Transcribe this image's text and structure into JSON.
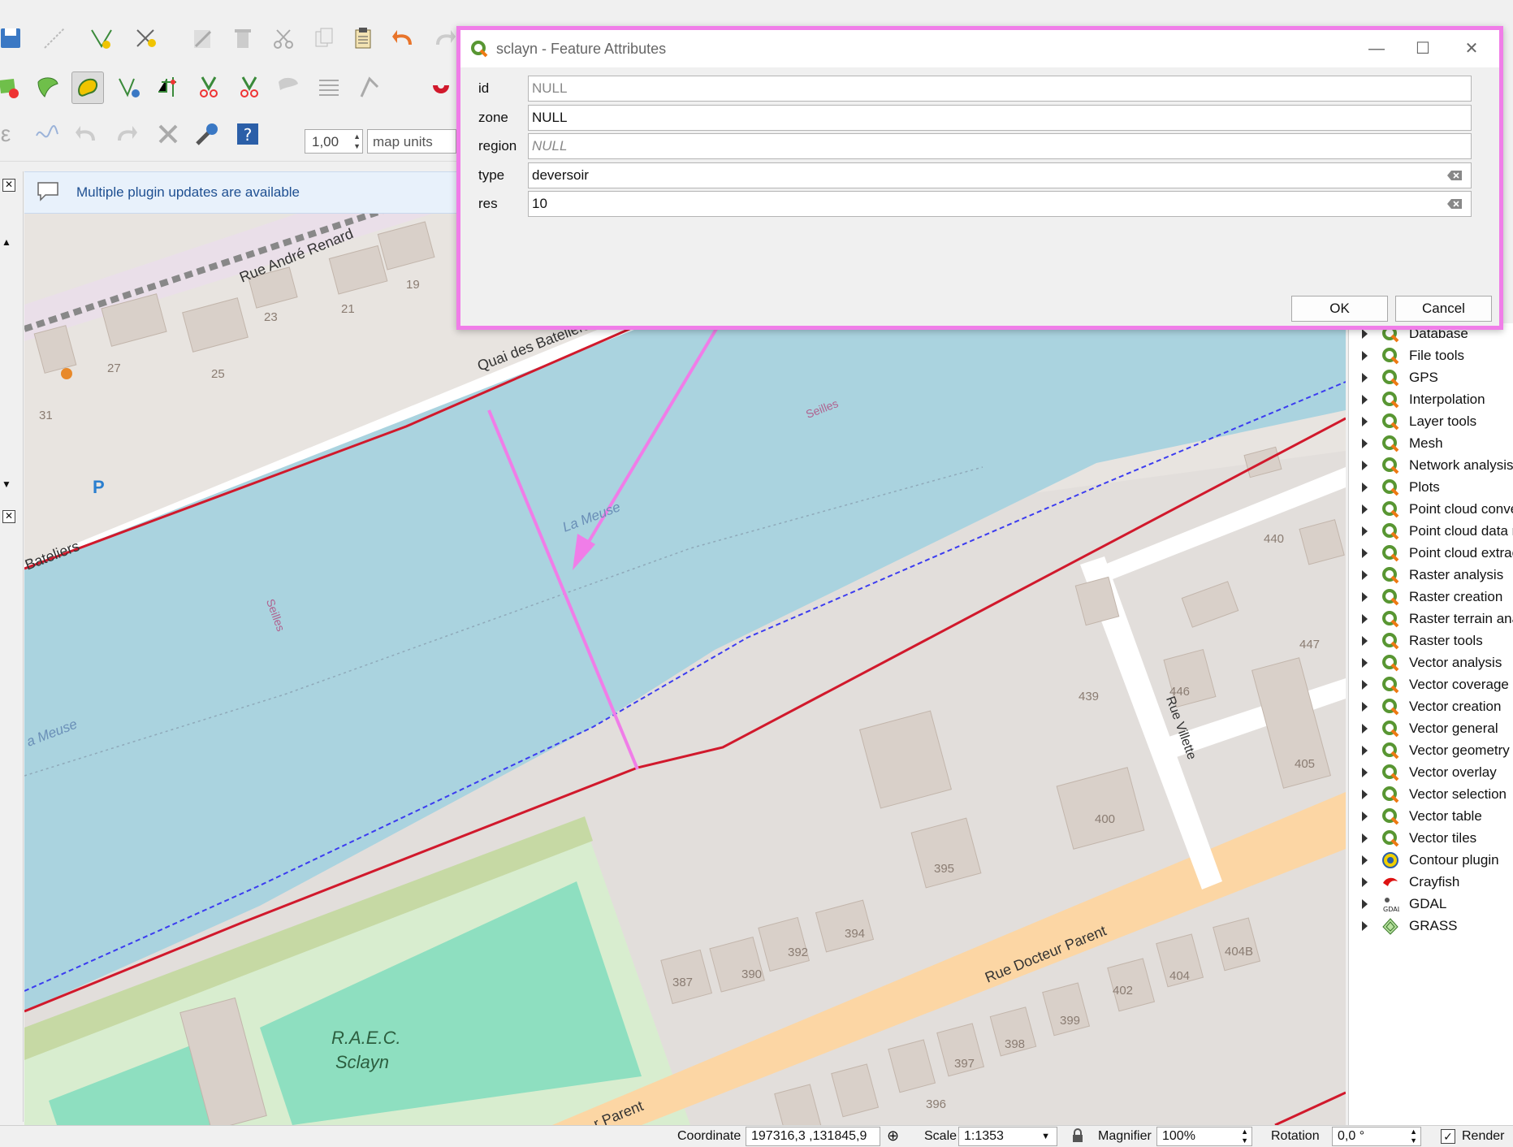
{
  "toolbar": {
    "line_width_value": "1,00",
    "units_value": "map units"
  },
  "notification": {
    "message": "Multiple plugin updates are available"
  },
  "map": {
    "labels": {
      "street_andre_renard": "Rue André Renard",
      "quai": "Quai des Bateliers",
      "bateliers": "Bateliers",
      "meuse_1": "La Meuse",
      "meuse_2": "a Meuse",
      "seilles_1": "Seilles",
      "seilles_2": "Seilles",
      "rue_villette": "Rue Villette",
      "rue_docteur": "Rue Docteur Parent",
      "rue_docteur_2": "r Parent",
      "raec": "R.A.E.C.",
      "sclayn": "Sclayn",
      "parking": "P"
    },
    "house_numbers": [
      "19",
      "21",
      "23",
      "25",
      "27",
      "31",
      "440",
      "447",
      "446",
      "439",
      "405",
      "400",
      "395",
      "394",
      "392",
      "390",
      "387",
      "404B",
      "404",
      "402",
      "399",
      "398",
      "397",
      "396"
    ]
  },
  "toolbox": {
    "items": [
      {
        "label": "Database",
        "icon": "qgis-icon"
      },
      {
        "label": "File tools",
        "icon": "qgis-icon"
      },
      {
        "label": "GPS",
        "icon": "qgis-icon"
      },
      {
        "label": "Interpolation",
        "icon": "qgis-icon"
      },
      {
        "label": "Layer tools",
        "icon": "qgis-icon"
      },
      {
        "label": "Mesh",
        "icon": "qgis-icon"
      },
      {
        "label": "Network analysis",
        "icon": "qgis-icon"
      },
      {
        "label": "Plots",
        "icon": "qgis-icon"
      },
      {
        "label": "Point cloud conve",
        "icon": "qgis-icon"
      },
      {
        "label": "Point cloud data r",
        "icon": "qgis-icon"
      },
      {
        "label": "Point cloud extrac",
        "icon": "qgis-icon"
      },
      {
        "label": "Raster analysis",
        "icon": "qgis-icon"
      },
      {
        "label": "Raster creation",
        "icon": "qgis-icon"
      },
      {
        "label": "Raster terrain ana",
        "icon": "qgis-icon"
      },
      {
        "label": "Raster tools",
        "icon": "qgis-icon"
      },
      {
        "label": "Vector analysis",
        "icon": "qgis-icon"
      },
      {
        "label": "Vector coverage",
        "icon": "qgis-icon"
      },
      {
        "label": "Vector creation",
        "icon": "qgis-icon"
      },
      {
        "label": "Vector general",
        "icon": "qgis-icon"
      },
      {
        "label": "Vector geometry",
        "icon": "qgis-icon"
      },
      {
        "label": "Vector overlay",
        "icon": "qgis-icon"
      },
      {
        "label": "Vector selection",
        "icon": "qgis-icon"
      },
      {
        "label": "Vector table",
        "icon": "qgis-icon"
      },
      {
        "label": "Vector tiles",
        "icon": "qgis-icon"
      },
      {
        "label": "Contour plugin",
        "icon": "contour-plugin-icon"
      },
      {
        "label": "Crayfish",
        "icon": "crayfish-icon"
      },
      {
        "label": "GDAL",
        "icon": "gdal-icon"
      },
      {
        "label": "GRASS",
        "icon": "grass-icon"
      }
    ]
  },
  "status": {
    "coordinate_label": "Coordinate",
    "coordinate_value": "197316,3 ,131845,9",
    "scale_label": "Scale",
    "scale_value": "1:1353",
    "magnifier_label": "Magnifier",
    "magnifier_value": "100%",
    "rotation_label": "Rotation",
    "rotation_value": "0,0 °",
    "render_label": "Render"
  },
  "dialog": {
    "title": "sclayn - Feature Attributes",
    "fields": [
      {
        "label": "id",
        "value": "NULL"
      },
      {
        "label": "zone",
        "value": "NULL"
      },
      {
        "label": "region",
        "value": "NULL"
      },
      {
        "label": "type",
        "value": "deversoir"
      },
      {
        "label": "res",
        "value": "10"
      }
    ],
    "ok_label": "OK",
    "cancel_label": "Cancel"
  },
  "colors": {
    "highlight": "#f07de8",
    "water": "#aad3df",
    "red_line": "#d1192c",
    "blue_dashed": "#3c3cf0",
    "road_orange": "#fcd6a4"
  }
}
